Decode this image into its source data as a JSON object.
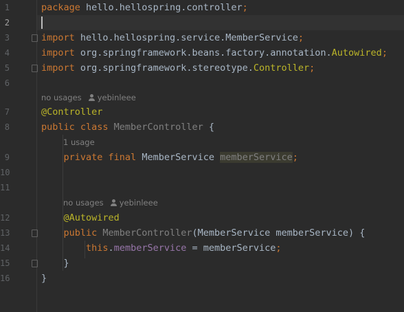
{
  "editor": {
    "lines": [
      {
        "n": "1",
        "tokens": [
          {
            "t": "package ",
            "c": "kw"
          },
          {
            "t": "hello.hellospring.controller",
            "c": "cls"
          },
          {
            "t": ";",
            "c": "kw"
          }
        ]
      },
      {
        "n": "2",
        "tokens": []
      },
      {
        "n": "3",
        "tokens": [
          {
            "t": "import ",
            "c": "kw"
          },
          {
            "t": "hello.hellospring.service.MemberService",
            "c": "cls"
          },
          {
            "t": ";",
            "c": "kw"
          }
        ]
      },
      {
        "n": "4",
        "tokens": [
          {
            "t": "import ",
            "c": "kw"
          },
          {
            "t": "org.springframework.beans.factory.annotation.",
            "c": "cls"
          },
          {
            "t": "Autowired",
            "c": "ann"
          },
          {
            "t": ";",
            "c": "kw"
          }
        ]
      },
      {
        "n": "5",
        "tokens": [
          {
            "t": "import ",
            "c": "kw"
          },
          {
            "t": "org.springframework.stereotype.",
            "c": "cls"
          },
          {
            "t": "Controller",
            "c": "ann"
          },
          {
            "t": ";",
            "c": "kw"
          }
        ]
      },
      {
        "n": "6",
        "tokens": []
      },
      {
        "n": "7",
        "tokens": [
          {
            "t": "@Controller",
            "c": "ann"
          }
        ]
      },
      {
        "n": "8",
        "tokens": [
          {
            "t": "public class ",
            "c": "kw"
          },
          {
            "t": "MemberController",
            "c": "gray"
          },
          {
            "t": " {",
            "c": "cls"
          }
        ]
      },
      {
        "n": "9",
        "tokens": [
          {
            "t": "    private final ",
            "c": "kw"
          },
          {
            "t": "MemberService ",
            "c": "cls"
          },
          {
            "t": "memberService",
            "c": "muted-field"
          },
          {
            "t": ";",
            "c": "kw"
          }
        ]
      },
      {
        "n": "10",
        "tokens": []
      },
      {
        "n": "11",
        "tokens": []
      },
      {
        "n": "12",
        "tokens": [
          {
            "t": "    @Autowired",
            "c": "ann"
          }
        ]
      },
      {
        "n": "13",
        "tokens": [
          {
            "t": "    public ",
            "c": "kw"
          },
          {
            "t": "MemberController",
            "c": "gray"
          },
          {
            "t": "(MemberService memberService) {",
            "c": "cls"
          }
        ]
      },
      {
        "n": "14",
        "tokens": [
          {
            "t": "        this",
            "c": "kw"
          },
          {
            "t": ".",
            "c": "cls"
          },
          {
            "t": "memberService",
            "c": "field"
          },
          {
            "t": " = memberService",
            "c": "cls"
          },
          {
            "t": ";",
            "c": "kw"
          }
        ]
      },
      {
        "n": "15",
        "tokens": [
          {
            "t": "    }",
            "c": "cls"
          }
        ]
      },
      {
        "n": "16",
        "tokens": [
          {
            "t": "}",
            "c": "cls"
          }
        ]
      }
    ],
    "hints": [
      {
        "before_line": 7,
        "usage": "no usages",
        "author": "yebinleee",
        "indent": 0
      },
      {
        "before_line": 9,
        "usage": "1 usage",
        "author": "",
        "indent": 1
      },
      {
        "before_line": 12,
        "usage": "no usages",
        "author": "yebinleee",
        "indent": 1
      }
    ]
  },
  "colors": {
    "background": "#2b2b2b",
    "keyword": "#cc7832",
    "annotation": "#bbb529",
    "text": "#a9b7c6",
    "field": "#9876aa",
    "line_number": "#606366"
  }
}
